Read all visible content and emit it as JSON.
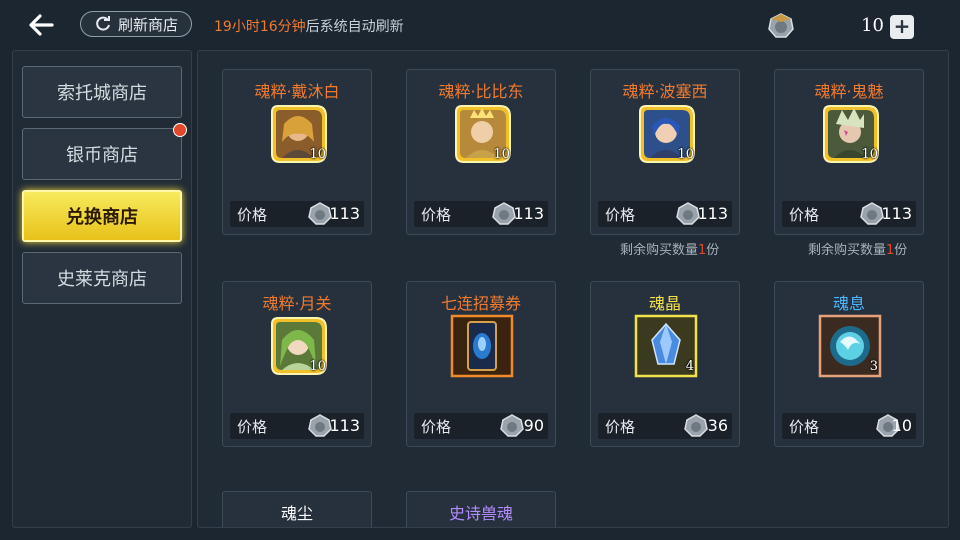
{
  "header": {
    "refresh_button": "刷新商店",
    "refresh_time": "19小时16分钟",
    "refresh_suffix": "后系统自动刷新",
    "currency_count": "10"
  },
  "sidebar": {
    "tabs": [
      {
        "label": "索托城商店"
      },
      {
        "label": "银币商店"
      },
      {
        "label": "兑换商店"
      },
      {
        "label": "史莱克商店"
      }
    ]
  },
  "price_label": "价格",
  "items": [
    {
      "name": "魂粹·戴沐白",
      "count": "10",
      "price": "113"
    },
    {
      "name": "魂粹·比比东",
      "count": "10",
      "price": "113"
    },
    {
      "name": "魂粹·波塞西",
      "count": "10",
      "price": "113",
      "remaining_prefix": "剩余购买数量",
      "remaining_num": "1",
      "remaining_suffix": "份"
    },
    {
      "name": "魂粹·鬼魅",
      "count": "10",
      "price": "113",
      "remaining_prefix": "剩余购买数量",
      "remaining_num": "1",
      "remaining_suffix": "份"
    },
    {
      "name": "魂粹·月关",
      "count": "10",
      "price": "113"
    },
    {
      "name": "七连招募券",
      "count": "",
      "price": "90"
    },
    {
      "name": "魂晶",
      "count": "4",
      "price": "36"
    },
    {
      "name": "魂息",
      "count": "3",
      "price": "10"
    },
    {
      "name": "魂尘"
    },
    {
      "name": "史诗兽魂"
    }
  ],
  "colors": {
    "orange": "#f07a2e",
    "yellow": "#f6e24a",
    "blue": "#4cb7ff",
    "purple": "#b38cff",
    "active_tab": "#f3d640"
  }
}
